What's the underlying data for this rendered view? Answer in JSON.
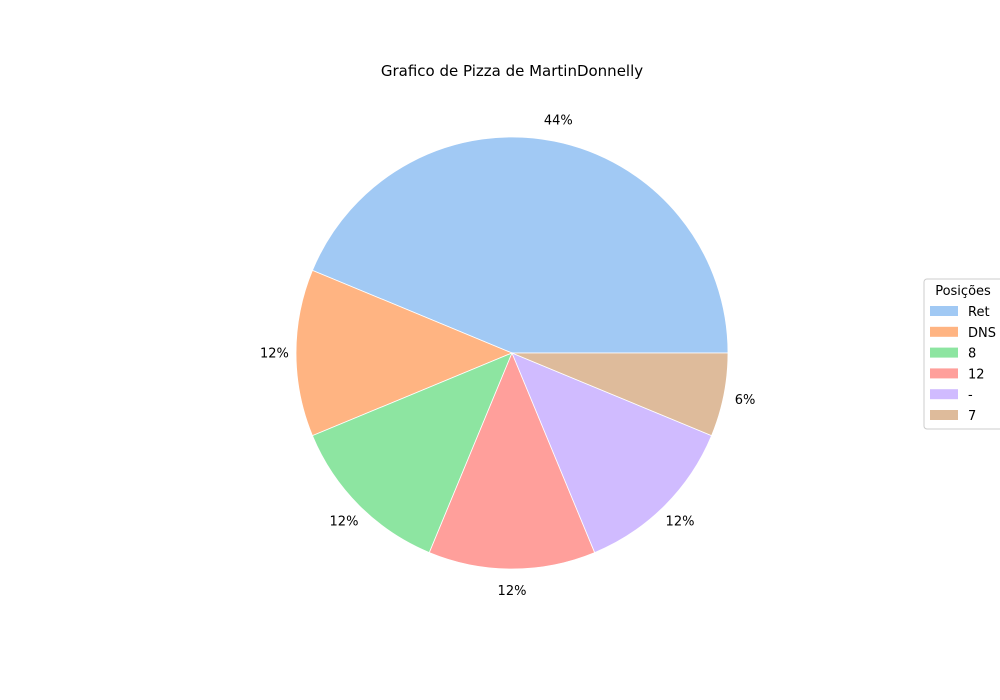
{
  "chart_data": {
    "type": "pie",
    "title": "Grafico de Pizza de MartinDonnelly",
    "legend": {
      "title": "Posições",
      "placement": "right"
    },
    "slices": [
      {
        "label": "Ret",
        "value": 43.75,
        "display": "44%",
        "color": "#a1c9f4"
      },
      {
        "label": "DNS",
        "value": 12.5,
        "display": "12%",
        "color": "#ffb482"
      },
      {
        "label": "8",
        "value": 12.5,
        "display": "12%",
        "color": "#8de5a1"
      },
      {
        "label": "12",
        "value": 12.5,
        "display": "12%",
        "color": "#ff9f9b"
      },
      {
        "label": "-",
        "value": 12.5,
        "display": "12%",
        "color": "#d0bbff"
      },
      {
        "label": "7",
        "value": 6.25,
        "display": "6%",
        "color": "#debb9b"
      }
    ]
  }
}
